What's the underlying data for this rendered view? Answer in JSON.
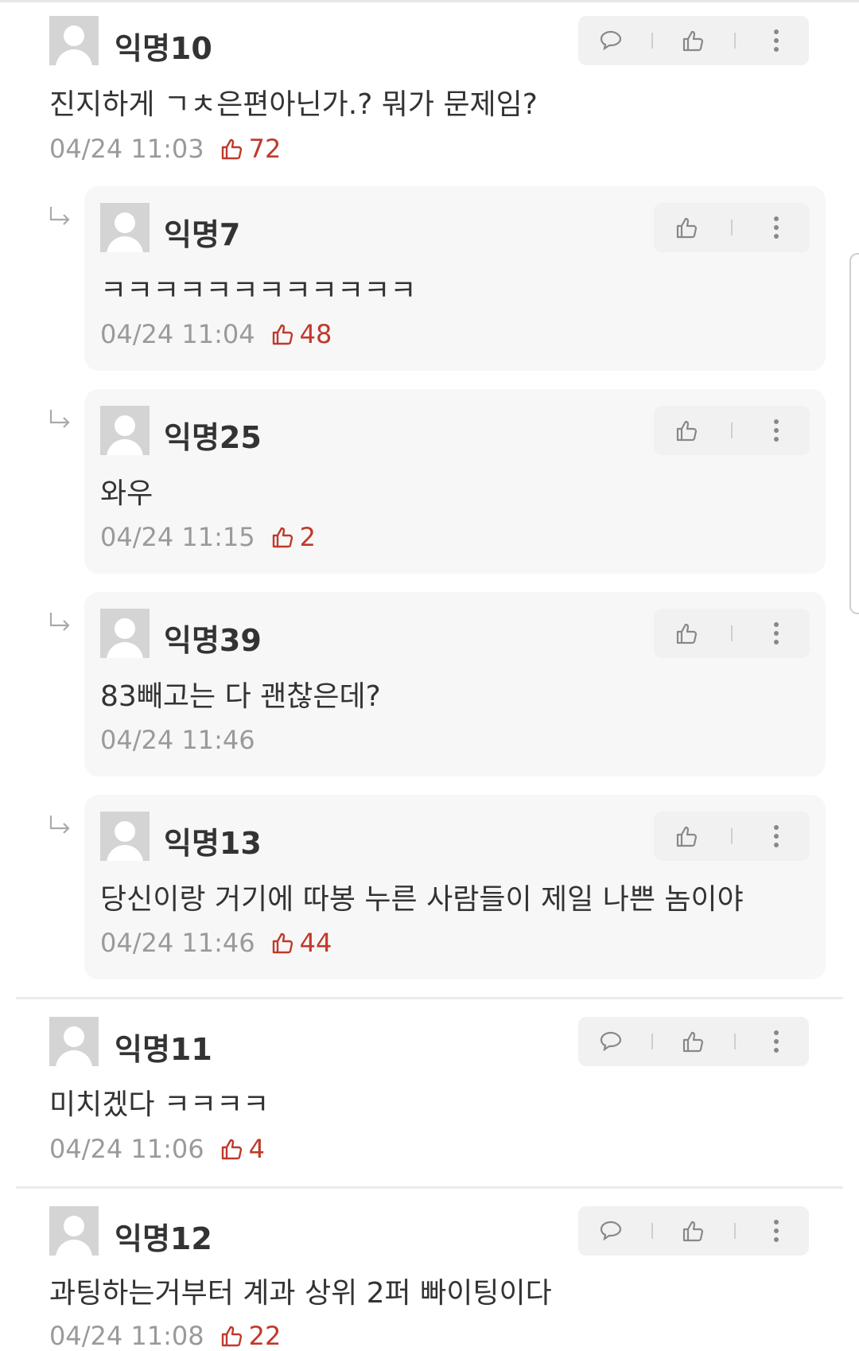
{
  "comments": [
    {
      "name": "익명10",
      "text": "진지하게 ㄱㅊ은편아닌가.? 뭐가 문제임?",
      "time": "04/24 11:03",
      "likes": "72"
    },
    {
      "name": "익명7",
      "text": "ㅋㅋㅋㅋㅋㅋㅋㅋㅋㅋㅋㅋ",
      "time": "04/24 11:04",
      "likes": "48"
    },
    {
      "name": "익명25",
      "text": "와우",
      "time": "04/24 11:15",
      "likes": "2"
    },
    {
      "name": "익명39",
      "text": "83빼고는 다 괜찮은데?",
      "time": "04/24 11:46",
      "likes": ""
    },
    {
      "name": "익명13",
      "text": "당신이랑 거기에 따봉 누른 사람들이 제일 나쁜 놈이야",
      "time": "04/24 11:46",
      "likes": "44"
    },
    {
      "name": "익명11",
      "text": "미치겠다 ㅋㅋㅋㅋ",
      "time": "04/24 11:06",
      "likes": "4"
    },
    {
      "name": "익명12",
      "text": "과팅하는거부터 계과 상위 2퍼 빠이팅이다",
      "time": "04/24 11:08",
      "likes": "22"
    }
  ],
  "colors": {
    "like": "#c0392b",
    "meta": "#9a9a9a",
    "card": "#f7f7f7"
  },
  "icons": {
    "reply": "chat-bubble-icon",
    "like": "thumbs-up-icon",
    "more": "vertical-dots-icon",
    "nested": "reply-arrow-icon"
  }
}
